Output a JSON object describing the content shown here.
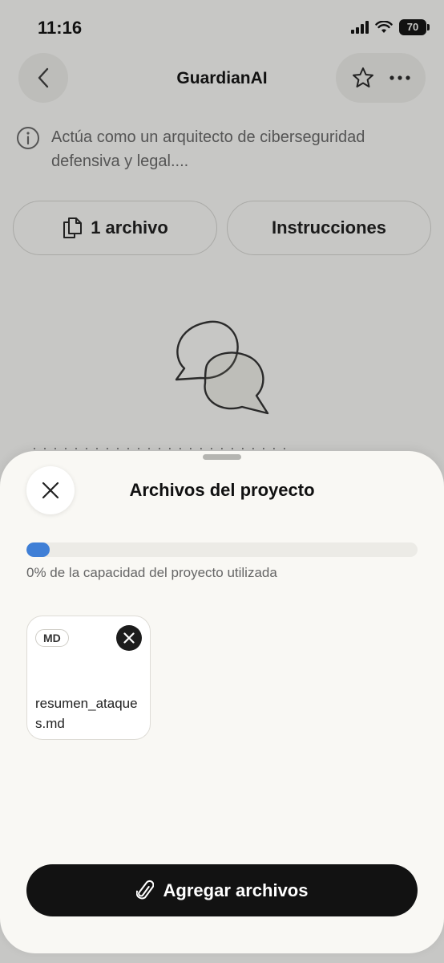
{
  "status_bar": {
    "time": "11:16",
    "battery": "70",
    "icons": [
      "signal-icon",
      "wifi-icon",
      "battery-icon"
    ]
  },
  "header": {
    "title": "GuardianAI",
    "icons": [
      "chevron-left-icon",
      "star-icon",
      "more-icon"
    ]
  },
  "project": {
    "description": "Actúa como un arquitecto de ciberseguridad defensiva y legal....",
    "files_button_label": "1 archivo",
    "instructions_button_label": "Instrucciones",
    "peek_text": "· · · · · · · · · · · · · · · · · · · · · · · · ·"
  },
  "sheet": {
    "title": "Archivos del proyecto",
    "capacity_label": "0% de la capacidad del proyecto utilizada",
    "capacity_fraction": 0.06,
    "accent_color": "#3f7fd6",
    "files": [
      {
        "type": "MD",
        "name": "resumen_ataques.md"
      }
    ],
    "add_button_label": "Agregar archivos"
  }
}
